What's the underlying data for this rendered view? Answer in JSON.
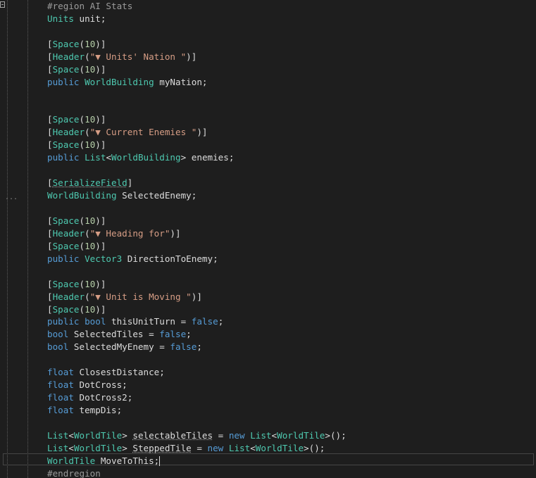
{
  "lines": [
    [
      {
        "t": "#region AI Stats",
        "c": "pp"
      }
    ],
    [
      {
        "t": "Units",
        "c": "ty"
      },
      {
        "t": " unit;",
        "c": "pl"
      }
    ],
    [],
    [
      {
        "t": "[",
        "c": "pl"
      },
      {
        "t": "Space",
        "c": "ty"
      },
      {
        "t": "(",
        "c": "pl"
      },
      {
        "t": "10",
        "c": "nm"
      },
      {
        "t": ")]",
        "c": "pl"
      }
    ],
    [
      {
        "t": "[",
        "c": "pl"
      },
      {
        "t": "Header",
        "c": "ty"
      },
      {
        "t": "(",
        "c": "pl"
      },
      {
        "t": "\"▼ Units' Nation \"",
        "c": "st"
      },
      {
        "t": ")]",
        "c": "pl"
      }
    ],
    [
      {
        "t": "[",
        "c": "pl"
      },
      {
        "t": "Space",
        "c": "ty"
      },
      {
        "t": "(",
        "c": "pl"
      },
      {
        "t": "10",
        "c": "nm"
      },
      {
        "t": ")]",
        "c": "pl"
      }
    ],
    [
      {
        "t": "public",
        "c": "kw"
      },
      {
        "t": " ",
        "c": "pl"
      },
      {
        "t": "WorldBuilding",
        "c": "ty"
      },
      {
        "t": " myNation;",
        "c": "pl"
      }
    ],
    [],
    [],
    [
      {
        "t": "[",
        "c": "pl"
      },
      {
        "t": "Space",
        "c": "ty"
      },
      {
        "t": "(",
        "c": "pl"
      },
      {
        "t": "10",
        "c": "nm"
      },
      {
        "t": ")]",
        "c": "pl"
      }
    ],
    [
      {
        "t": "[",
        "c": "pl"
      },
      {
        "t": "Header",
        "c": "ty"
      },
      {
        "t": "(",
        "c": "pl"
      },
      {
        "t": "\"▼ Current Enemies \"",
        "c": "st"
      },
      {
        "t": ")]",
        "c": "pl"
      }
    ],
    [
      {
        "t": "[",
        "c": "pl"
      },
      {
        "t": "Space",
        "c": "ty"
      },
      {
        "t": "(",
        "c": "pl"
      },
      {
        "t": "10",
        "c": "nm"
      },
      {
        "t": ")]",
        "c": "pl"
      }
    ],
    [
      {
        "t": "public",
        "c": "kw"
      },
      {
        "t": " ",
        "c": "pl"
      },
      {
        "t": "List",
        "c": "ty"
      },
      {
        "t": "<",
        "c": "pl"
      },
      {
        "t": "WorldBuilding",
        "c": "ty"
      },
      {
        "t": "> enemies;",
        "c": "pl"
      }
    ],
    [],
    [
      {
        "t": "[",
        "c": "pl"
      },
      {
        "t": "SerializeField",
        "c": "ty",
        "u": true
      },
      {
        "t": "]",
        "c": "pl"
      }
    ],
    [
      {
        "t": "WorldBuilding",
        "c": "ty"
      },
      {
        "t": " SelectedEnemy;",
        "c": "pl"
      }
    ],
    [],
    [
      {
        "t": "[",
        "c": "pl"
      },
      {
        "t": "Space",
        "c": "ty"
      },
      {
        "t": "(",
        "c": "pl"
      },
      {
        "t": "10",
        "c": "nm"
      },
      {
        "t": ")]",
        "c": "pl"
      }
    ],
    [
      {
        "t": "[",
        "c": "pl"
      },
      {
        "t": "Header",
        "c": "ty"
      },
      {
        "t": "(",
        "c": "pl"
      },
      {
        "t": "\"▼ Heading for\"",
        "c": "st"
      },
      {
        "t": ")]",
        "c": "pl"
      }
    ],
    [
      {
        "t": "[",
        "c": "pl"
      },
      {
        "t": "Space",
        "c": "ty"
      },
      {
        "t": "(",
        "c": "pl"
      },
      {
        "t": "10",
        "c": "nm"
      },
      {
        "t": ")]",
        "c": "pl"
      }
    ],
    [
      {
        "t": "public",
        "c": "kw"
      },
      {
        "t": " ",
        "c": "pl"
      },
      {
        "t": "Vector3",
        "c": "ty"
      },
      {
        "t": " DirectionToEnemy;",
        "c": "pl"
      }
    ],
    [],
    [
      {
        "t": "[",
        "c": "pl"
      },
      {
        "t": "Space",
        "c": "ty"
      },
      {
        "t": "(",
        "c": "pl"
      },
      {
        "t": "10",
        "c": "nm"
      },
      {
        "t": ")]",
        "c": "pl"
      }
    ],
    [
      {
        "t": "[",
        "c": "pl"
      },
      {
        "t": "Header",
        "c": "ty"
      },
      {
        "t": "(",
        "c": "pl"
      },
      {
        "t": "\"▼ Unit is Moving \"",
        "c": "st"
      },
      {
        "t": ")]",
        "c": "pl"
      }
    ],
    [
      {
        "t": "[",
        "c": "pl"
      },
      {
        "t": "Space",
        "c": "ty"
      },
      {
        "t": "(",
        "c": "pl"
      },
      {
        "t": "10",
        "c": "nm"
      },
      {
        "t": ")]",
        "c": "pl"
      }
    ],
    [
      {
        "t": "public",
        "c": "kw"
      },
      {
        "t": " ",
        "c": "pl"
      },
      {
        "t": "bool",
        "c": "kw"
      },
      {
        "t": " thisUnitTurn = ",
        "c": "pl"
      },
      {
        "t": "false",
        "c": "kw"
      },
      {
        "t": ";",
        "c": "pl"
      }
    ],
    [
      {
        "t": "bool",
        "c": "kw"
      },
      {
        "t": " SelectedTiles = ",
        "c": "pl"
      },
      {
        "t": "false",
        "c": "kw"
      },
      {
        "t": ";",
        "c": "pl"
      }
    ],
    [
      {
        "t": "bool",
        "c": "kw"
      },
      {
        "t": " SelectedMyEnemy = ",
        "c": "pl"
      },
      {
        "t": "false",
        "c": "kw"
      },
      {
        "t": ";",
        "c": "pl"
      }
    ],
    [],
    [
      {
        "t": "float",
        "c": "kw"
      },
      {
        "t": " ClosestDistance;",
        "c": "pl"
      }
    ],
    [
      {
        "t": "float",
        "c": "kw"
      },
      {
        "t": " DotCross;",
        "c": "pl"
      }
    ],
    [
      {
        "t": "float",
        "c": "kw"
      },
      {
        "t": " DotCross2;",
        "c": "pl"
      }
    ],
    [
      {
        "t": "float",
        "c": "kw"
      },
      {
        "t": " tempDis;",
        "c": "pl"
      }
    ],
    [],
    [
      {
        "t": "List",
        "c": "ty"
      },
      {
        "t": "<",
        "c": "pl"
      },
      {
        "t": "WorldTile",
        "c": "ty"
      },
      {
        "t": "> ",
        "c": "pl"
      },
      {
        "t": "selectableTiles",
        "c": "pl",
        "u": true
      },
      {
        "t": " = ",
        "c": "pl"
      },
      {
        "t": "new",
        "c": "kw"
      },
      {
        "t": " ",
        "c": "pl"
      },
      {
        "t": "List",
        "c": "ty"
      },
      {
        "t": "<",
        "c": "pl"
      },
      {
        "t": "WorldTile",
        "c": "ty"
      },
      {
        "t": ">();",
        "c": "pl"
      }
    ],
    [
      {
        "t": "List",
        "c": "ty"
      },
      {
        "t": "<",
        "c": "pl"
      },
      {
        "t": "WorldTile",
        "c": "ty"
      },
      {
        "t": "> ",
        "c": "pl"
      },
      {
        "t": "SteppedTile",
        "c": "pl",
        "u": true
      },
      {
        "t": " = ",
        "c": "pl"
      },
      {
        "t": "new",
        "c": "kw"
      },
      {
        "t": " ",
        "c": "pl"
      },
      {
        "t": "List",
        "c": "ty"
      },
      {
        "t": "<",
        "c": "pl"
      },
      {
        "t": "WorldTile",
        "c": "ty"
      },
      {
        "t": ">();",
        "c": "pl"
      }
    ],
    [
      {
        "t": "WorldTile",
        "c": "ty"
      },
      {
        "t": " MoveToThis;",
        "c": "pl"
      },
      {
        "caret": true
      }
    ],
    [
      {
        "t": "#endregion",
        "c": "pp"
      }
    ]
  ],
  "gutter": {
    "collapse_icon": "collapse-minus-icon",
    "ellipsis_text": "..."
  },
  "colors": {
    "background": "#1e1e1e",
    "keyword": "#569cd6",
    "type": "#4ec9b0",
    "string": "#d69d85",
    "number": "#b5cea8",
    "preprocessor": "#9b9b9b",
    "plain": "#dcdcdc"
  }
}
